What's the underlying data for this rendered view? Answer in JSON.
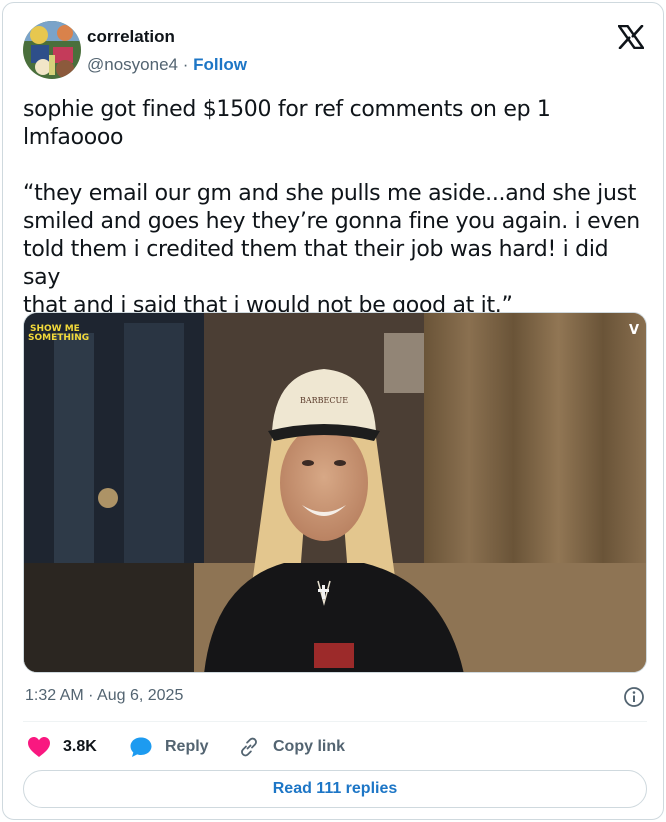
{
  "author": {
    "name": "correlation",
    "handle": "@nosyone4",
    "separator": "·",
    "follow_label": "Follow"
  },
  "tweet": {
    "text": "sophie got fined $1500 for ref comments on ep 1\nlmfaoooo\n\n“they email our gm and she pulls me aside...and she just\nsmiled and goes hey they’re gonna fine you again. i even\ntold them i credited them that their job was hard! i did say\nthat and i said that i would not be good at it.”",
    "timestamp": "1:32 AM · Aug 6, 2025"
  },
  "media": {
    "overlay_logo": "SHOW ME\nSOMETHING",
    "corner_badge": "V",
    "hat_text": "BARBECUE"
  },
  "actions": {
    "like_count": "3.8K",
    "reply_label": "Reply",
    "copy_link_label": "Copy link"
  },
  "read_replies_label": "Read 111 replies",
  "icons": {
    "brand": "x-logo-icon",
    "like": "heart-icon",
    "reply": "speech-bubble-icon",
    "copy": "link-icon",
    "info": "info-icon"
  },
  "colors": {
    "accent": "#1d76c6",
    "like": "#f91880",
    "reply": "#1d9bf0",
    "muted": "#536471"
  }
}
